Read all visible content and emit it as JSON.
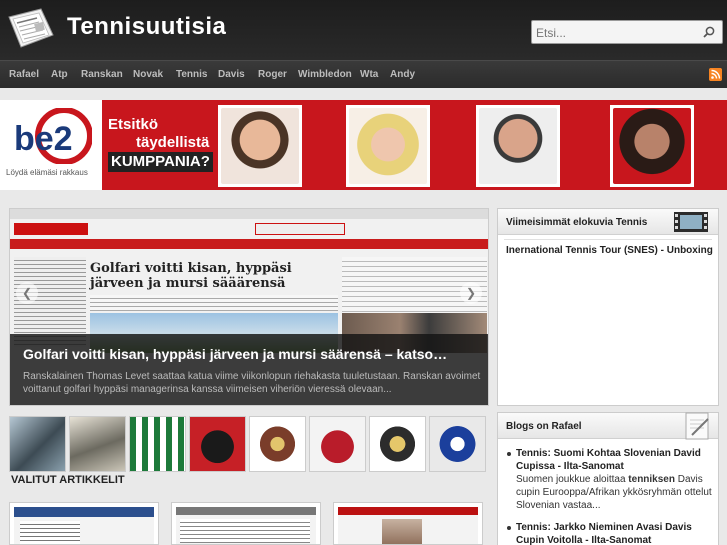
{
  "header": {
    "site_title": "Tennisuutisia",
    "search_placeholder": "Etsi..."
  },
  "nav": {
    "items": [
      "Rafael",
      "Atp",
      "Ranskan",
      "Novak",
      "Tennis",
      "Davis",
      "Roger",
      "Wimbledon",
      "Wta",
      "Andy"
    ]
  },
  "banner": {
    "brand": "be2",
    "tagline": "Löydä elämäsi rakkaus",
    "line1": "Etsitkö",
    "line2": "täydellistä",
    "line3": "KUMPPANIA?"
  },
  "slider": {
    "headline_image_text": "Golfari voitti kisan, hyppäsi järveen ja mursi sääärensä",
    "caption_title": "Golfari voitti kisan, hyppäsi järveen ja mursi säärensä – katso…",
    "caption_text": "Ranskalainen Thomas Levet saattaa katua viime viikonlopun riehakasta tuuletustaan. Ranskan avoimet voittanut golfari hyppäsi managerinsa kanssa viimeisen viheriön vieressä olevaan..."
  },
  "main": {
    "section_title": "VALITUT ARTIKKELIT"
  },
  "sidebar": {
    "videos_title": "Viimeisimmät elokuvia Tennis",
    "video_item": "Inernational Tennis Tour (SNES) - Unboxing",
    "blogs_title": "Blogs on Rafael",
    "blogs": [
      {
        "title": "Tennis: Suomi Kohtaa Slovenian David Cupissa - Ilta-Sanomat",
        "desc_before": "Suomen joukkue aloittaa ",
        "desc_bold": "tenniksen",
        "desc_after": " Davis cupin Eurooppa/Afrikan ykkösryhmän ottelut Slovenian vastaa..."
      },
      {
        "title": "Tennis: Jarkko Nieminen Avasi Davis Cupin Voitolla - Ilta-Sanomat"
      }
    ]
  },
  "colors": {
    "header_bg": "#1d1d1d",
    "banner_red": "#c8161d",
    "rss_orange": "#f78422"
  }
}
